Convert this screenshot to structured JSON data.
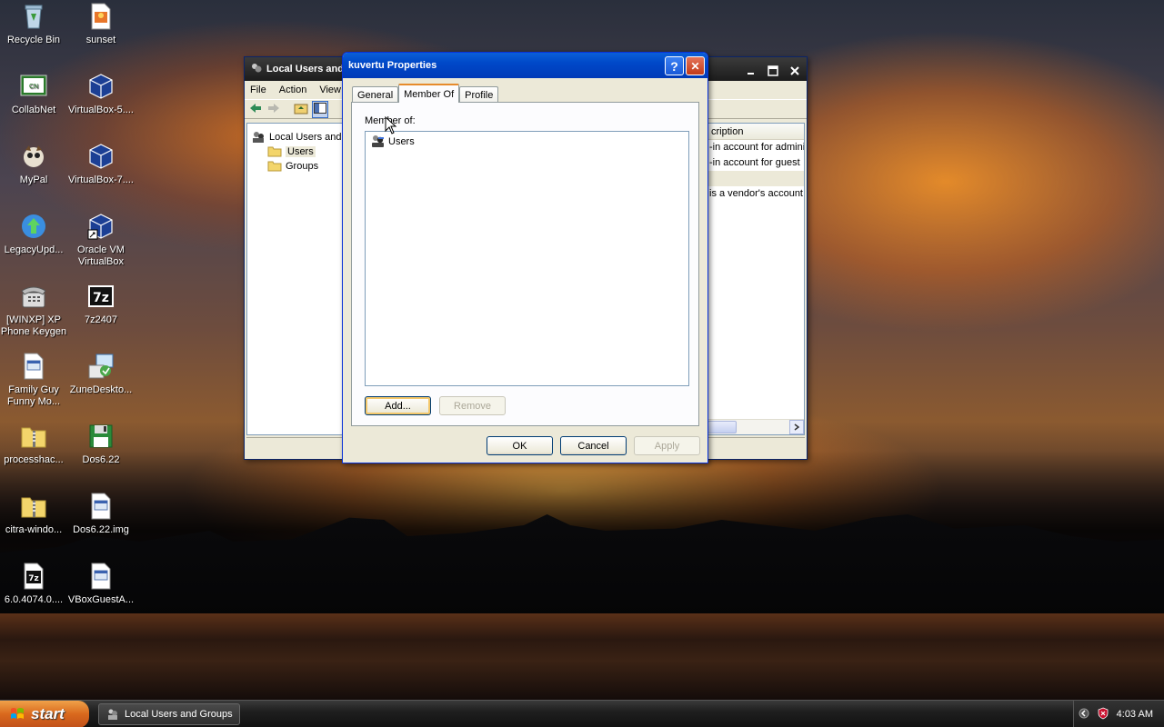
{
  "desktop_icons": [
    {
      "label": "Recycle Bin",
      "icon": "recycle-bin-icon"
    },
    {
      "label": "sunset",
      "icon": "image-file-icon"
    },
    {
      "label": "CollabNet",
      "icon": "collabnet-icon"
    },
    {
      "label": "VirtualBox-5....",
      "icon": "virtualbox-icon"
    },
    {
      "label": "MyPal",
      "icon": "mypal-browser-icon"
    },
    {
      "label": "VirtualBox-7....",
      "icon": "virtualbox-icon"
    },
    {
      "label": "LegacyUpd...",
      "icon": "legacy-update-icon"
    },
    {
      "label": "Oracle VM VirtualBox",
      "icon": "virtualbox-shortcut-icon"
    },
    {
      "label": "[WINXP] XP Phone Keygen",
      "icon": "phone-icon"
    },
    {
      "label": "7z2407",
      "icon": "7zip-icon"
    },
    {
      "label": "Family Guy Funny Mo...",
      "icon": "document-icon"
    },
    {
      "label": "ZuneDeskto...",
      "icon": "installer-icon"
    },
    {
      "label": "processhac...",
      "icon": "zip-folder-icon"
    },
    {
      "label": "Dos6.22",
      "icon": "floppy-icon"
    },
    {
      "label": "citra-windo...",
      "icon": "zip-folder-icon"
    },
    {
      "label": "Dos6.22.img",
      "icon": "document-icon"
    },
    {
      "label": "6.0.4074.0....",
      "icon": "7zip-archive-icon"
    },
    {
      "label": "VBoxGuestA...",
      "icon": "document-icon"
    }
  ],
  "mmc_window": {
    "title": "Local Users and",
    "menu": [
      "File",
      "Action",
      "View"
    ],
    "tree": {
      "root": "Local Users and G",
      "children": [
        "Users",
        "Groups"
      ],
      "selected": "Users"
    },
    "column_header": "cription",
    "rows": [
      "-in account for adminis",
      "-in account for guest",
      "",
      "is a vendor's account"
    ]
  },
  "dialog": {
    "title": "kuvertu Properties",
    "tabs": [
      "General",
      "Member Of",
      "Profile"
    ],
    "selected_tab": "Member Of",
    "member_of_label": "Member of:",
    "members": [
      "Users"
    ],
    "add_label": "Add...",
    "remove_label": "Remove",
    "ok_label": "OK",
    "cancel_label": "Cancel",
    "apply_label": "Apply",
    "help_glyph": "?",
    "close_glyph": "✕"
  },
  "taskbar": {
    "start_label": "start",
    "task_label": "Local Users and Groups",
    "clock": "4:03 AM"
  },
  "colors": {
    "dialog_title_active": "#0048c8",
    "tab_highlight": "#e68b2c",
    "start_orange": "#d9681c"
  }
}
